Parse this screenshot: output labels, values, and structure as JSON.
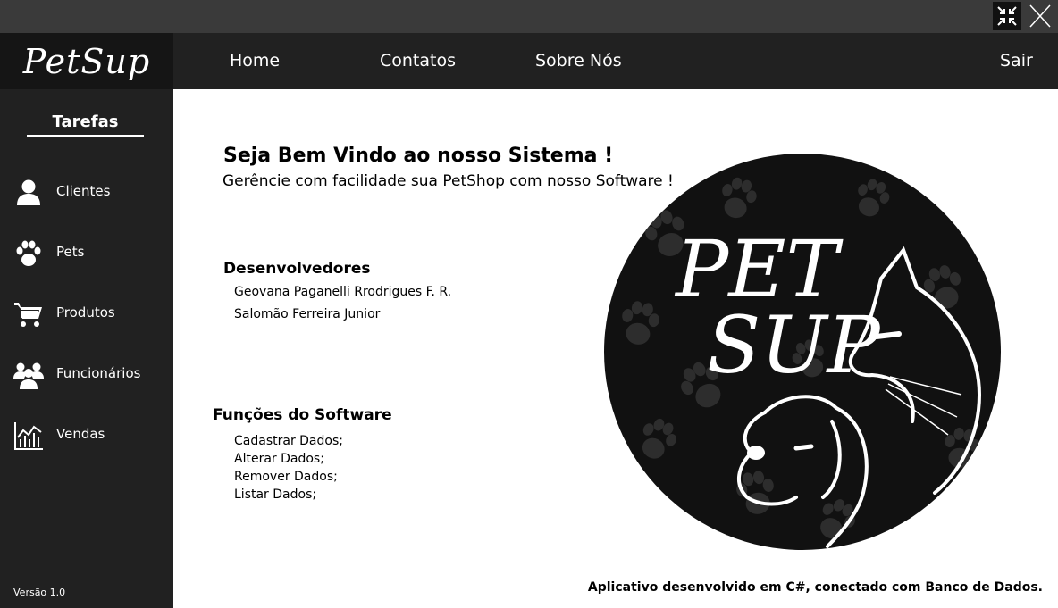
{
  "window": {
    "restore_icon": "compress-arrows-icon",
    "close_icon": "close-x-icon"
  },
  "brand": {
    "name": "PetSup"
  },
  "topnav": {
    "items": [
      {
        "label": "Home"
      },
      {
        "label": "Contatos"
      },
      {
        "label": "Sobre Nós"
      }
    ],
    "logout_label": "Sair"
  },
  "sidebar": {
    "heading": "Tarefas",
    "items": [
      {
        "label": "Clientes",
        "icon": "person-icon"
      },
      {
        "label": "Pets",
        "icon": "paw-icon"
      },
      {
        "label": "Produtos",
        "icon": "cart-icon"
      },
      {
        "label": "Funcionários",
        "icon": "group-icon"
      },
      {
        "label": "Vendas",
        "icon": "chart-icon"
      }
    ],
    "version": "Versão 1.0"
  },
  "main": {
    "welcome": "Seja Bem Vindo ao nosso Sistema !",
    "subtitle": "Gerêncie com facilidade sua PetShop com nosso Software !",
    "developers_title": "Desenvolvedores",
    "developers": [
      "Geovana Paganelli Rrodrigues F. R.",
      "Salomão Ferreira Junior"
    ],
    "functions_title": "Funções do Software",
    "functions": [
      "Cadastrar Dados;",
      "Alterar Dados;",
      "Remover Dados;",
      "Listar Dados;"
    ],
    "logo_text": [
      "PET",
      "SUP"
    ],
    "footer": "Aplicativo desenvolvido em C#, conectado com Banco de Dados."
  },
  "colors": {
    "titlebar": "#3a3a3a",
    "sidebar": "#212121",
    "brand_bg": "#151515",
    "content_bg": "#ffffff"
  }
}
